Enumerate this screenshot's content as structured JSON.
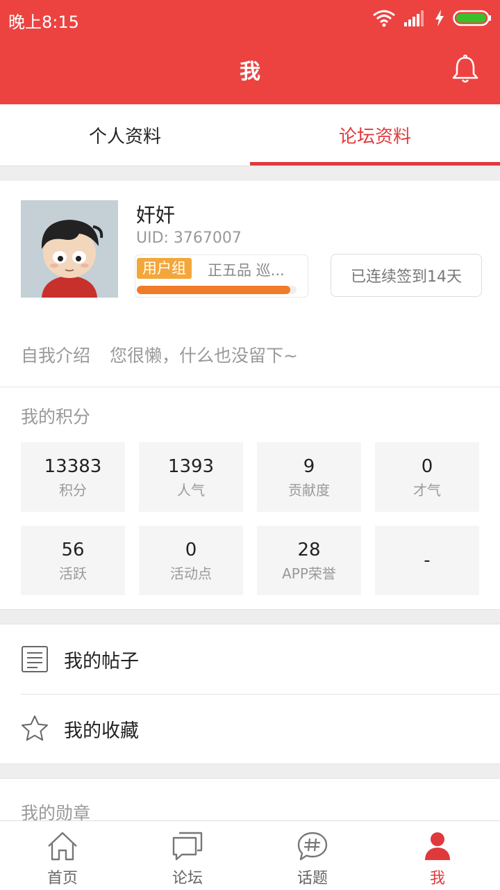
{
  "status_bar": {
    "time": "晚上8:15"
  },
  "header": {
    "title": "我"
  },
  "tabs": [
    {
      "label": "个人资料",
      "active": false
    },
    {
      "label": "论坛资料",
      "active": true
    }
  ],
  "profile": {
    "name": "奸奸",
    "uid": "UID: 3767007",
    "group_tag": "用户组",
    "group_rank": "正五品  巡...",
    "progress": 0.96,
    "checkin_label": "已连续签到14天",
    "intro_label": "自我介绍",
    "intro_text": "您很懒，什么也没留下~"
  },
  "points": {
    "title": "我的积分",
    "items": [
      {
        "value": "13383",
        "label": "积分"
      },
      {
        "value": "1393",
        "label": "人气"
      },
      {
        "value": "9",
        "label": "贡献度"
      },
      {
        "value": "0",
        "label": "才气"
      },
      {
        "value": "56",
        "label": "活跃"
      },
      {
        "value": "0",
        "label": "活动点"
      },
      {
        "value": "28",
        "label": "APP荣誉"
      },
      {
        "value": "-",
        "label": ""
      }
    ]
  },
  "menu": [
    {
      "label": "我的帖子",
      "icon": "document-icon"
    },
    {
      "label": "我的收藏",
      "icon": "star-icon"
    }
  ],
  "medals": {
    "title": "我的勋章"
  },
  "bottom_nav": [
    {
      "label": "首页",
      "icon": "home-icon",
      "active": false
    },
    {
      "label": "论坛",
      "icon": "chat-icon",
      "active": false
    },
    {
      "label": "话题",
      "icon": "hashtag-icon",
      "active": false
    },
    {
      "label": "我",
      "icon": "user-icon",
      "active": true
    }
  ],
  "colors": {
    "brand": "#ec4341",
    "accent": "#e0393c",
    "group_tag": "#f3a73b",
    "progress": "#f07b28"
  }
}
